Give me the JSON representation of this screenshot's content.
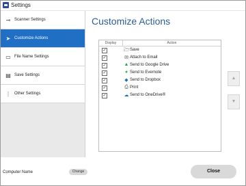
{
  "window": {
    "title": "Settings"
  },
  "sidebar": {
    "items": [
      {
        "label": "Scanner Settings",
        "icon": "scanner-icon"
      },
      {
        "label": "Customize Actions",
        "icon": "send-icon"
      },
      {
        "label": "File Name Settings",
        "icon": "file-name-icon"
      },
      {
        "label": "Save Settings",
        "icon": "save-settings-icon"
      },
      {
        "label": "Other Settings",
        "icon": "more-vertical-icon"
      }
    ]
  },
  "main": {
    "title": "Customize Actions",
    "columns": {
      "display": "Display",
      "action": "Action"
    },
    "actions": [
      {
        "label": "Save",
        "checked": true,
        "icon": "folder-save-icon"
      },
      {
        "label": "Attach to Email",
        "checked": true,
        "icon": "email-icon"
      },
      {
        "label": "Send to Google Drive",
        "checked": true,
        "icon": "google-drive-icon"
      },
      {
        "label": "Send to Evernote",
        "checked": true,
        "icon": "evernote-icon"
      },
      {
        "label": "Send to Dropbox",
        "checked": true,
        "icon": "dropbox-icon"
      },
      {
        "label": "Print",
        "checked": true,
        "icon": "printer-icon"
      },
      {
        "label": "Send to OneDrive®",
        "checked": true,
        "icon": "onedrive-icon"
      }
    ]
  },
  "footer": {
    "computer_name_label": "Computer Name",
    "change_label": "Change",
    "close_label": "Close"
  },
  "colors": {
    "accent": "#1f6fc5",
    "title_blue": "#2a5d9c",
    "sidebar_bg": "#e9e9e9"
  }
}
